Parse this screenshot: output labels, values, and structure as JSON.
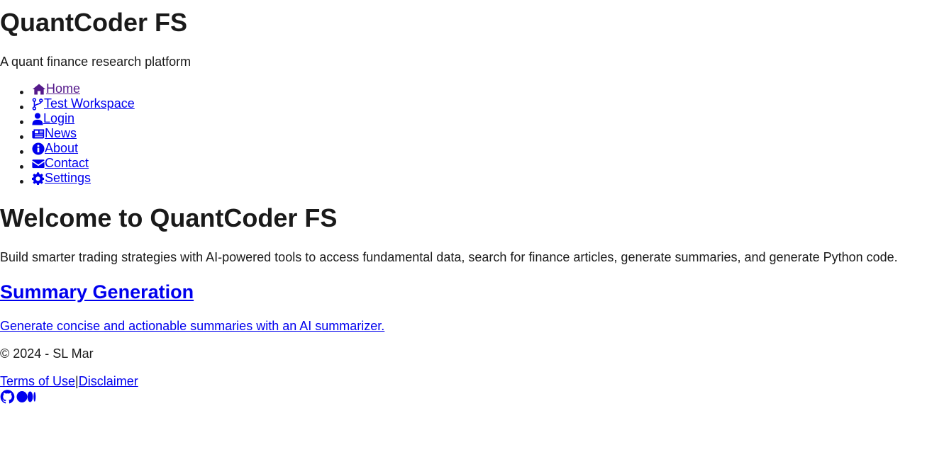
{
  "header": {
    "title": "QuantCoder FS",
    "tagline": "A quant finance research platform"
  },
  "nav": {
    "items": [
      {
        "label": "Home",
        "icon": "home-icon"
      },
      {
        "label": "Test Workspace",
        "icon": "code-branch-icon"
      },
      {
        "label": "Login",
        "icon": "user-icon"
      },
      {
        "label": "News",
        "icon": "newspaper-icon"
      },
      {
        "label": "About",
        "icon": "info-circle-icon"
      },
      {
        "label": "Contact",
        "icon": "envelope-icon"
      },
      {
        "label": "Settings",
        "icon": "gear-icon"
      }
    ]
  },
  "main": {
    "heading": "Welcome to QuantCoder FS",
    "intro": "Build smarter trading strategies with AI-powered tools to access fundamental data, search for finance articles, generate summaries, and generate Python code.",
    "feature": {
      "title": "Summary Generation",
      "description": "Generate concise and actionable summaries with an AI summarizer."
    }
  },
  "footer": {
    "copyright": "© 2024 - SL Mar",
    "terms": "Terms of Use",
    "separator": "|",
    "disclaimer": "Disclaimer",
    "social": [
      "github-icon",
      "medium-icon"
    ]
  },
  "colors": {
    "link": "#0000ee",
    "visited_link": "#551a8b",
    "text": "#1a1a1a"
  }
}
